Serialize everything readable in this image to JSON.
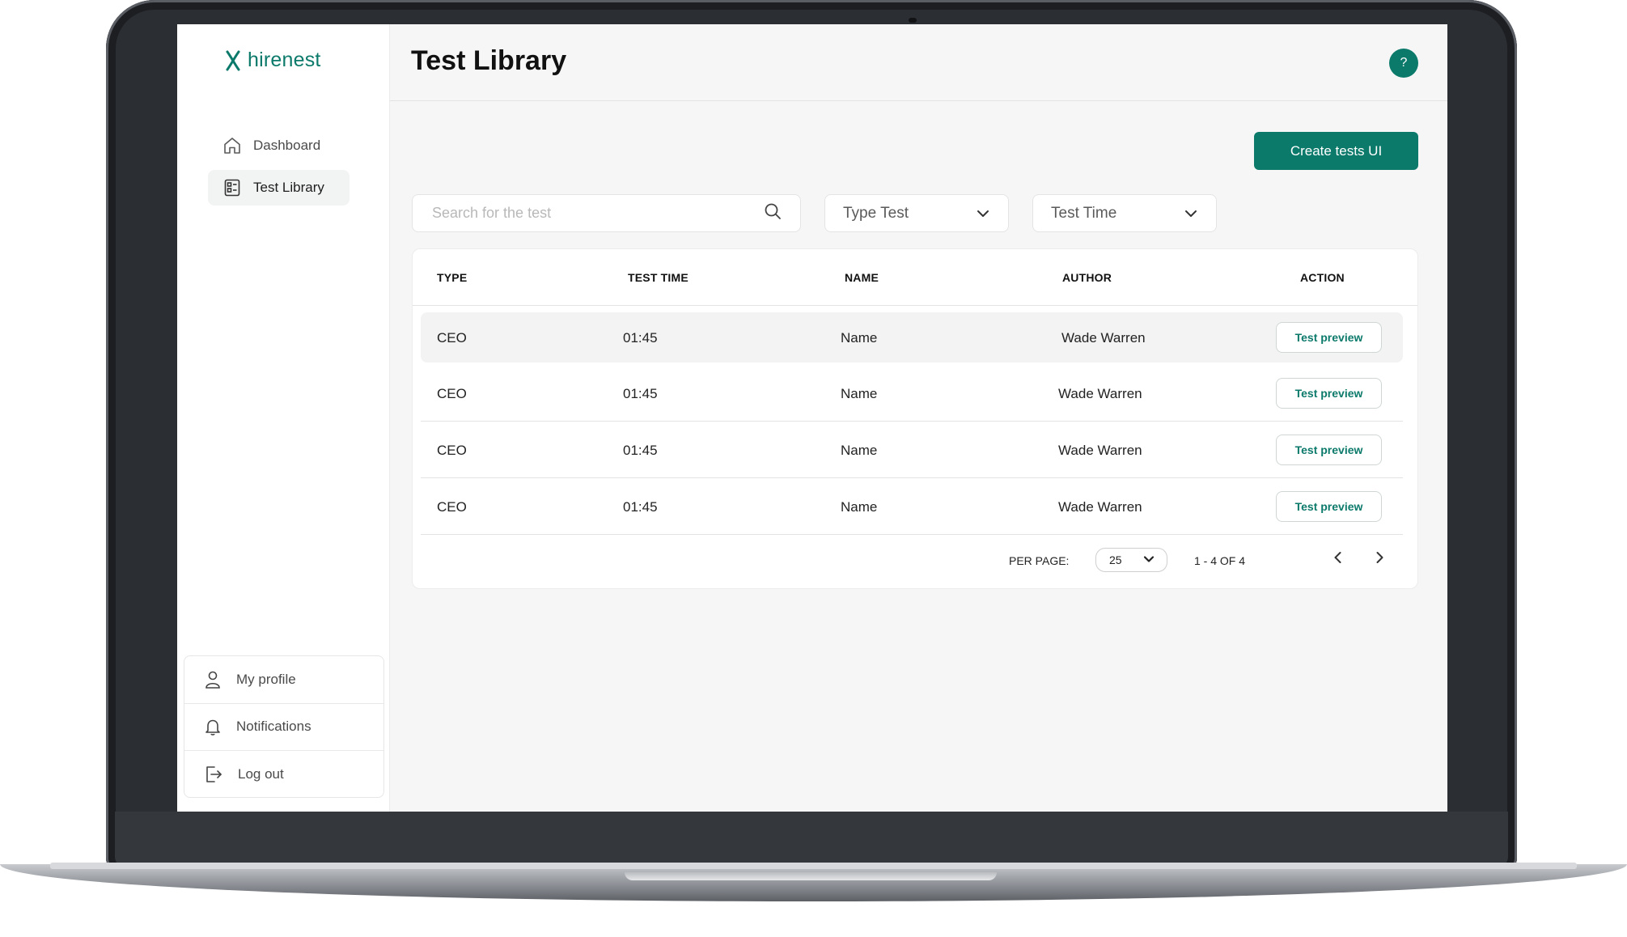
{
  "app": {
    "brand": "hirenest",
    "brand_color": "#0c7a6b"
  },
  "sidebar": {
    "items": [
      {
        "label": "Dashboard",
        "icon": "home-icon",
        "active": false
      },
      {
        "label": "Test Library",
        "icon": "test-library-icon",
        "active": true
      }
    ],
    "bottom_items": [
      {
        "label": "My profile",
        "icon": "user-icon"
      },
      {
        "label": "Notifications",
        "icon": "bell-icon"
      },
      {
        "label": "Log out",
        "icon": "logout-icon"
      }
    ]
  },
  "header": {
    "title": "Test Library",
    "help_label": "?"
  },
  "toolbar": {
    "create_label": "Create tests UI"
  },
  "filters": {
    "search_placeholder": "Search for the test",
    "search_value": "",
    "type_test": "Type Test",
    "test_time": "Test Time"
  },
  "table": {
    "columns": [
      "TYPE",
      "TEST TIME",
      "NAME",
      "AUTHOR",
      "ACTION"
    ],
    "rows": [
      {
        "type": "CEO",
        "test_time": "01:45",
        "name": "Name",
        "author": "Wade Warren",
        "action": "Test preview"
      },
      {
        "type": "CEO",
        "test_time": "01:45",
        "name": "Name",
        "author": "Wade Warren",
        "action": "Test preview"
      },
      {
        "type": "CEO",
        "test_time": "01:45",
        "name": "Name",
        "author": "Wade Warren",
        "action": "Test preview"
      },
      {
        "type": "CEO",
        "test_time": "01:45",
        "name": "Name",
        "author": "Wade Warren",
        "action": "Test preview"
      }
    ]
  },
  "pagination": {
    "per_page_label": "PER PAGE:",
    "per_page_value": "25",
    "range_text": "1 - 4 OF 4"
  }
}
